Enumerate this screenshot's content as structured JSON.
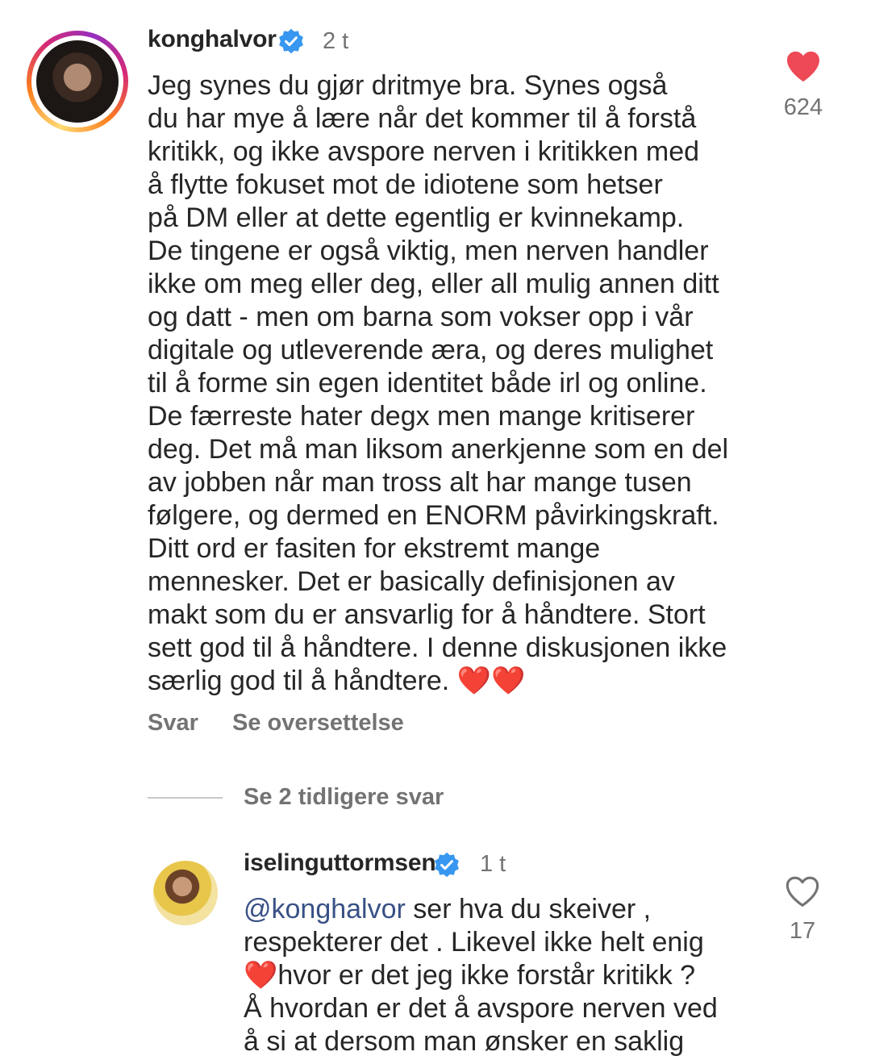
{
  "comments": [
    {
      "username": "konghalvor",
      "verified": true,
      "timestamp": "2 t",
      "body_lines": [
        "Jeg synes du gjør dritmye bra. Synes også",
        "du har mye å lære når det kommer til å forstå",
        "kritikk, og ikke avspore nerven i kritikken med",
        "å flytte fokuset mot de idiotene som hetser",
        "på DM eller at dette egentlig er kvinnekamp.",
        "De tingene er også viktig, men nerven handler",
        "ikke om meg eller deg, eller all mulig annen ditt",
        "og datt - men om barna som vokser opp i vår",
        "digitale og utleverende æra, og deres mulighet",
        "til å forme sin egen identitet både irl og online.",
        "De færreste hater degx men mange kritiserer",
        "deg. Det må man liksom anerkjenne som en del",
        "av jobben når man tross alt har mange tusen",
        "følgere, og dermed en ENORM påvirkingskraft.",
        "Ditt ord er fasiten for ekstremt mange",
        "mennesker. Det er basically definisjonen av",
        "makt som du er ansvarlig for å håndtere. Stort",
        "sett god til å håndtere. I denne diskusjonen ikke",
        "særlig god til å håndtere. ❤️❤️"
      ],
      "likes": "624",
      "liked": true,
      "reply_label": "Svar",
      "translate_label": "Se oversettelse",
      "heart_icon": "heart-filled-icon",
      "heart_color": "#ed4956"
    },
    {
      "username": "iselinguttormsen",
      "verified": true,
      "timestamp": "1 t",
      "mention": "@konghalvor",
      "body_first_rest": " ser hva du skeiver ,",
      "body_lines": [
        "respekterer det . Likevel ikke helt enig",
        "❤️hvor er det jeg ikke forstår kritikk ?",
        "Å hvordan er det å avspore nerven ved",
        "å si at dersom man ønsker en saklig"
      ],
      "likes": "17",
      "liked": false,
      "heart_icon": "heart-outline-icon"
    }
  ],
  "view_replies_label": "Se 2 tidligere svar",
  "colors": {
    "verified_badge": "#3897f0",
    "muted_text": "#737373",
    "mention": "#385185"
  }
}
